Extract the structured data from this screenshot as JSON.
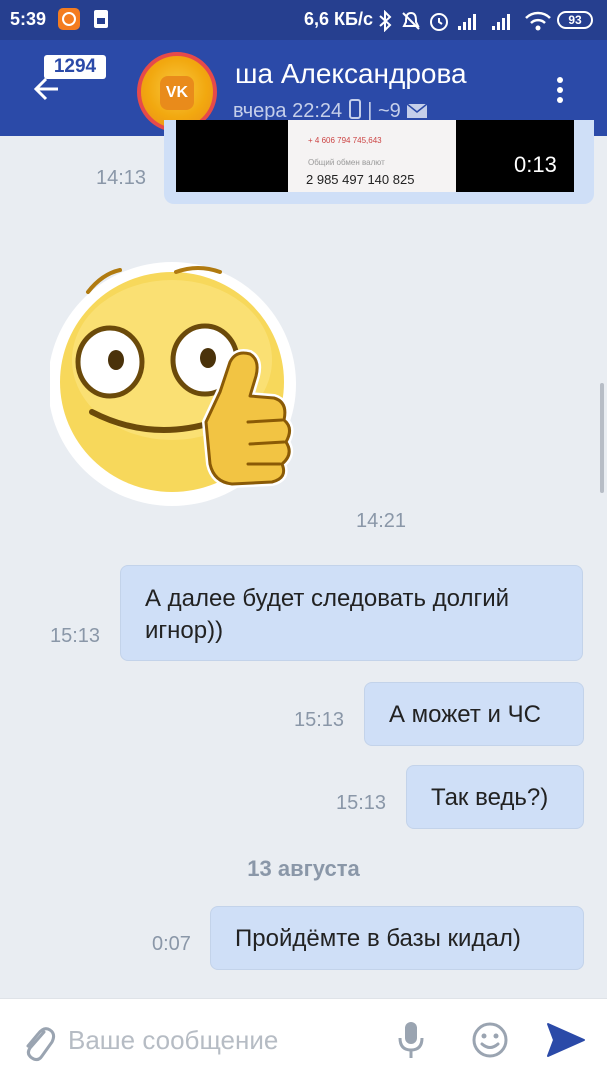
{
  "status_bar": {
    "time": "5:39",
    "speed": "6,6 КБ/с",
    "battery": "93",
    "icons": [
      "app-icon",
      "sim-icon",
      "bluetooth-icon",
      "mute-icon",
      "alarm-icon",
      "signal-icon",
      "signal-icon",
      "wifi-icon",
      "battery-icon"
    ]
  },
  "header": {
    "back_icon": "arrow-left-icon",
    "unread_count": "1294",
    "avatar_text": "VK",
    "contact_name": "ша Александрова",
    "last_seen": "вчера 22:24",
    "last_seen_suffix": "| ~9",
    "menu_icon": "more-vert-icon",
    "colors": {
      "header_bg": "#2b4aa8",
      "status_bg": "#263f8f"
    }
  },
  "video_message": {
    "screenshot_amount": "2 985 497 140 825",
    "screenshot_line1": "+ 4 606 794 745,643",
    "screenshot_line2": "Общий обмен валют",
    "duration": "0:13",
    "time": "14:13"
  },
  "sticker": {
    "icon": "smiley-thumbs-up-icon",
    "time": "14:21"
  },
  "messages": [
    {
      "text_line1": "А далее будет следовать долгий",
      "text_line2": "игнор))",
      "time": "15:13"
    },
    {
      "text": "А может и ЧС",
      "time": "15:13"
    },
    {
      "text": "Так ведь?)",
      "time": "15:13"
    },
    {
      "text": "Пройдёмте в базы кидал)",
      "time": "0:07"
    }
  ],
  "date_separator": "13 августа",
  "input_bar": {
    "placeholder": "Ваше сообщение",
    "icons": [
      "attach-icon",
      "mic-icon",
      "emoji-icon",
      "send-icon"
    ],
    "accent_color": "#2b4aa8"
  }
}
